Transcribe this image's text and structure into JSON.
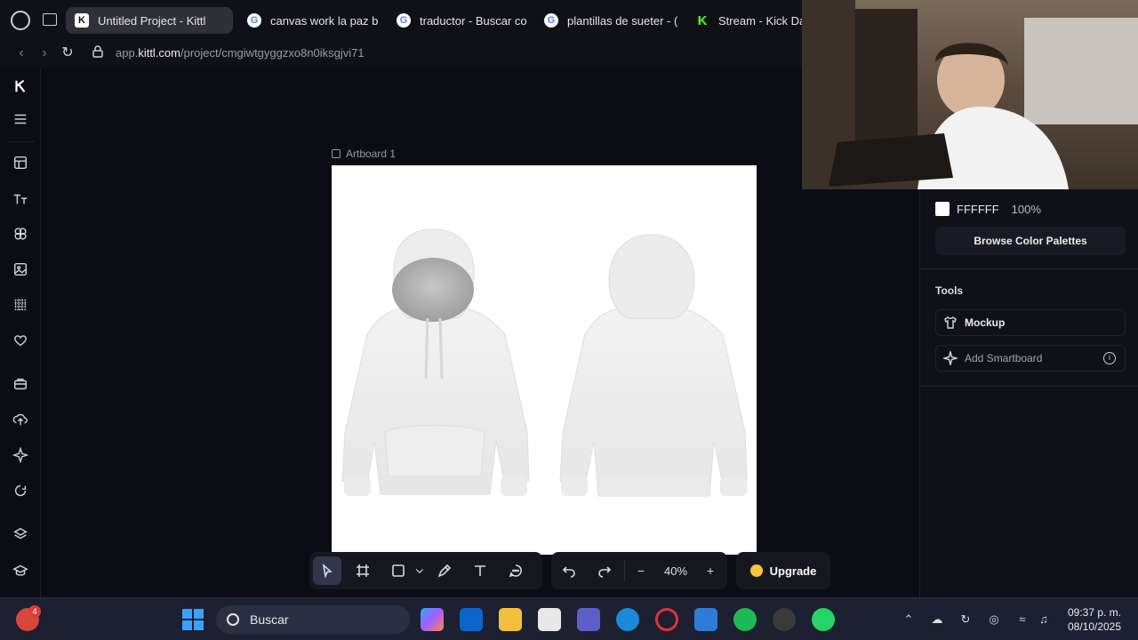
{
  "browser": {
    "tabs": [
      {
        "label": "Untitled Project - Kittl",
        "favicon": "kittl-icon",
        "active": true
      },
      {
        "label": "canvas work la paz b",
        "favicon": "google-icon",
        "active": false
      },
      {
        "label": "traductor - Buscar co",
        "favicon": "google-icon",
        "active": false
      },
      {
        "label": "plantillas de sueter - (",
        "favicon": "google-icon",
        "active": false
      },
      {
        "label": "Stream - Kick Das",
        "favicon": "kick-icon",
        "active": false
      }
    ],
    "url_prefix": "app.",
    "url_domain": "kittl.com",
    "url_path": "/project/cmgiwtgyggzxo8n0iksgjvi71"
  },
  "left_toolbar": {
    "items": [
      "kittl-logo-icon",
      "menu-icon",
      "templates-icon",
      "text-icon",
      "elements-icon",
      "images-icon",
      "grid-icon",
      "favorites-icon",
      "briefcase-icon",
      "upload-icon",
      "ai-sparkle-icon",
      "comments-icon",
      "layers-icon",
      "learn-icon"
    ]
  },
  "canvas": {
    "artboard_label": "Artboard 1"
  },
  "bottom_toolbar": {
    "zoom": "40%",
    "zoom_minus": "−",
    "zoom_plus": "+",
    "upgrade_label": "Upgrade"
  },
  "right_panel": {
    "color_hex": "FFFFFF",
    "color_opacity": "100%",
    "browse_palettes_label": "Browse Color Palettes",
    "tools_title": "Tools",
    "mockup_label": "Mockup",
    "add_smartboard_label": "Add Smartboard"
  },
  "taskbar": {
    "search_label": "Buscar",
    "time": "09:37 p. m.",
    "date": "08/10/2025",
    "notification_count": "4"
  },
  "colors": {
    "background": "#0b0c14",
    "panel": "#0f1018",
    "accent_upgrade": "#f5c542",
    "taskbar": "#1c2030"
  }
}
